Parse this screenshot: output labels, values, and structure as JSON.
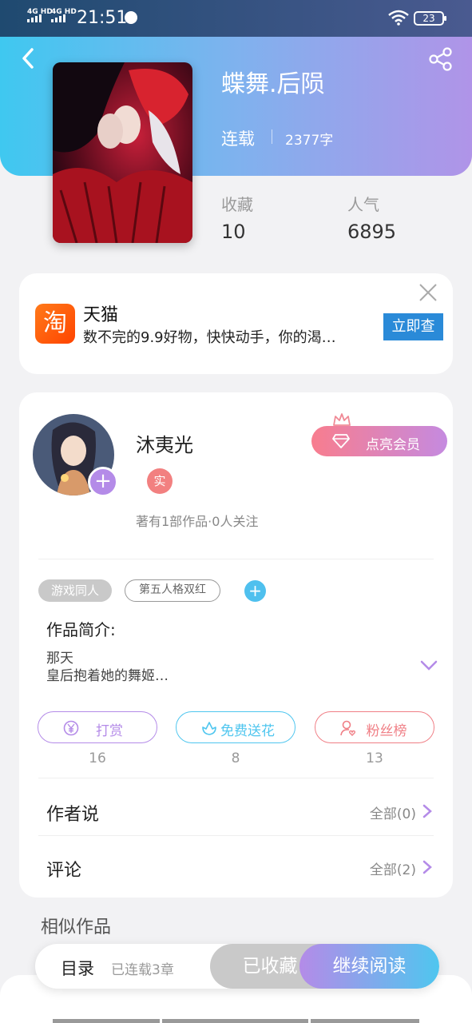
{
  "status_bar": {
    "net1": "4G HD",
    "net2": "4G HD",
    "time": "21:51",
    "battery": "23"
  },
  "book": {
    "title": "蝶舞.后陨",
    "status": "连载",
    "word_count": "2377字",
    "stats": [
      {
        "label": "收藏",
        "value": "10"
      },
      {
        "label": "人气",
        "value": "6895"
      }
    ]
  },
  "ad": {
    "logo_char": "淘",
    "title": "天猫",
    "description": "数不完的9.9好物，快快动手，你的渴…",
    "cta": "立即查"
  },
  "author": {
    "name": "沐夷光",
    "verified_badge": "实",
    "meta": "著有1部作品·0人关注",
    "vip_button": "点亮会员"
  },
  "tags": [
    "游戏同人",
    "第五人格双红"
  ],
  "intro": {
    "label": "作品简介:",
    "text": "那天\n皇后抱着她的舞姬…"
  },
  "actions": [
    {
      "label": "打赏",
      "count": "16",
      "color": "#b48be8"
    },
    {
      "label": "免费送花",
      "count": "8",
      "color": "#4fc6ef"
    },
    {
      "label": "粉丝榜",
      "count": "13",
      "color": "#f07f86"
    }
  ],
  "rows": [
    {
      "title": "作者说",
      "right": "全部(0)"
    },
    {
      "title": "评论",
      "right": "全部(2)"
    }
  ],
  "similar_title": "相似作品",
  "bottom_bar": {
    "toc": "目录",
    "progress": "已连载3章",
    "favorited": "已收藏",
    "continue": "继续阅读"
  }
}
